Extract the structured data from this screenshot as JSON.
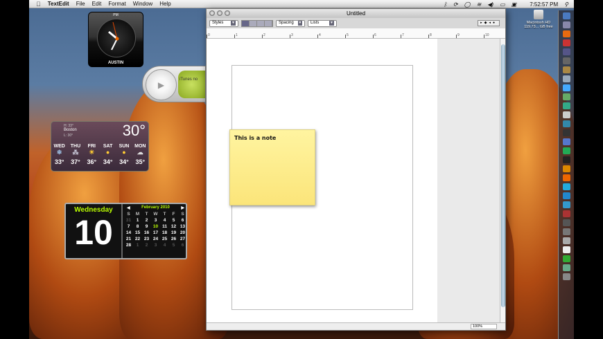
{
  "menubar": {
    "app": "TextEdit",
    "items": [
      "File",
      "Edit",
      "Format",
      "Window",
      "Help"
    ],
    "time": "7:52:57 PM"
  },
  "clock": {
    "period": "PM",
    "city": "AUSTIN"
  },
  "itunes": {
    "label": "iTunes no"
  },
  "weather": {
    "city": "Boston",
    "hi": "H: 33°",
    "lo": "L: 30°",
    "current": "30°",
    "days": [
      {
        "d": "WED",
        "t": "33°",
        "i": "snow"
      },
      {
        "d": "THU",
        "t": "37°",
        "i": "flurries"
      },
      {
        "d": "FRI",
        "t": "36°",
        "i": "partly-sunny"
      },
      {
        "d": "SAT",
        "t": "34°",
        "i": "sunny"
      },
      {
        "d": "SUN",
        "t": "34°",
        "i": "sunny"
      },
      {
        "d": "MON",
        "t": "35°",
        "i": "cloudy"
      }
    ]
  },
  "calendar": {
    "weekday": "Wednesday",
    "day": "10",
    "month": "February 2010",
    "headers": [
      "S",
      "M",
      "T",
      "W",
      "T",
      "F",
      "S"
    ],
    "cells": [
      "31",
      "1",
      "2",
      "3",
      "4",
      "5",
      "6",
      "7",
      "8",
      "9",
      "10",
      "11",
      "12",
      "13",
      "14",
      "15",
      "16",
      "17",
      "18",
      "19",
      "20",
      "21",
      "22",
      "23",
      "24",
      "25",
      "26",
      "27",
      "28",
      "1",
      "2",
      "3",
      "4",
      "5",
      "6"
    ]
  },
  "desktop": {
    "disk_name": "Macintosh HD",
    "disk_info": "119.73... GB free"
  },
  "window": {
    "title": "Untitled",
    "styles": "Styles",
    "spacing": "Spacing",
    "lists": "Lists",
    "ruler": [
      "0",
      "1",
      "2",
      "3",
      "4",
      "5",
      "6",
      "7",
      "8",
      "9",
      "10"
    ],
    "zoom": "100%"
  },
  "note": {
    "text": "This is a note"
  }
}
